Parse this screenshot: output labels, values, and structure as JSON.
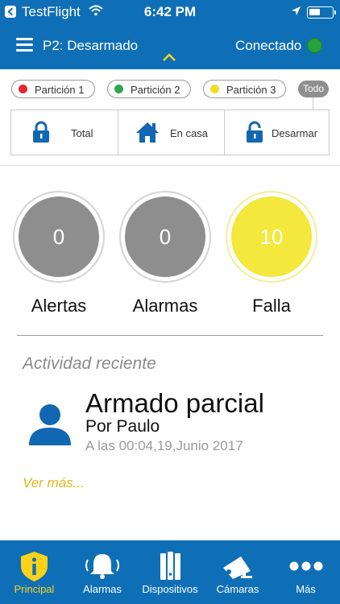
{
  "status_bar": {
    "back_app": "TestFlight",
    "time": "6:42 PM"
  },
  "header": {
    "title": "P2: Desarmado",
    "connection": "Conectado",
    "connection_color": "#29a13a"
  },
  "partitions": [
    {
      "label": "Partición 1",
      "color": "#e0282e"
    },
    {
      "label": "Partición 2",
      "color": "#2fa84f"
    },
    {
      "label": "Partición 3",
      "color": "#f1dd26"
    }
  ],
  "all_button": "Todo",
  "arm_buttons": [
    {
      "label": "Total",
      "icon": "lock-icon"
    },
    {
      "label": "En casa",
      "icon": "home-icon"
    },
    {
      "label": "Desarmar",
      "icon": "unlock-icon"
    }
  ],
  "stats": [
    {
      "value": "0",
      "label": "Alertas",
      "color": "#8e8e8e"
    },
    {
      "value": "0",
      "label": "Alarmas",
      "color": "#8e8e8e"
    },
    {
      "value": "10",
      "label": "Falla",
      "color": "#f3e83b"
    }
  ],
  "recent": {
    "title": "Actividad reciente",
    "event": "Armado parcial",
    "by": "Por Paulo",
    "timestamp": "A las 00:04,19,Junio 2017",
    "more": "Ver más..."
  },
  "tabs": [
    {
      "label": "Principal",
      "icon": "shield-info-icon",
      "active": true
    },
    {
      "label": "Alarmas",
      "icon": "bell-icon",
      "active": false
    },
    {
      "label": "Dispositivos",
      "icon": "devices-icon",
      "active": false
    },
    {
      "label": "Cámaras",
      "icon": "camera-icon",
      "active": false
    },
    {
      "label": "Más",
      "icon": "more-icon",
      "active": false
    }
  ],
  "colors": {
    "primary": "#0f6fb6",
    "accent": "#ffd21a",
    "link": "#e3b718"
  }
}
